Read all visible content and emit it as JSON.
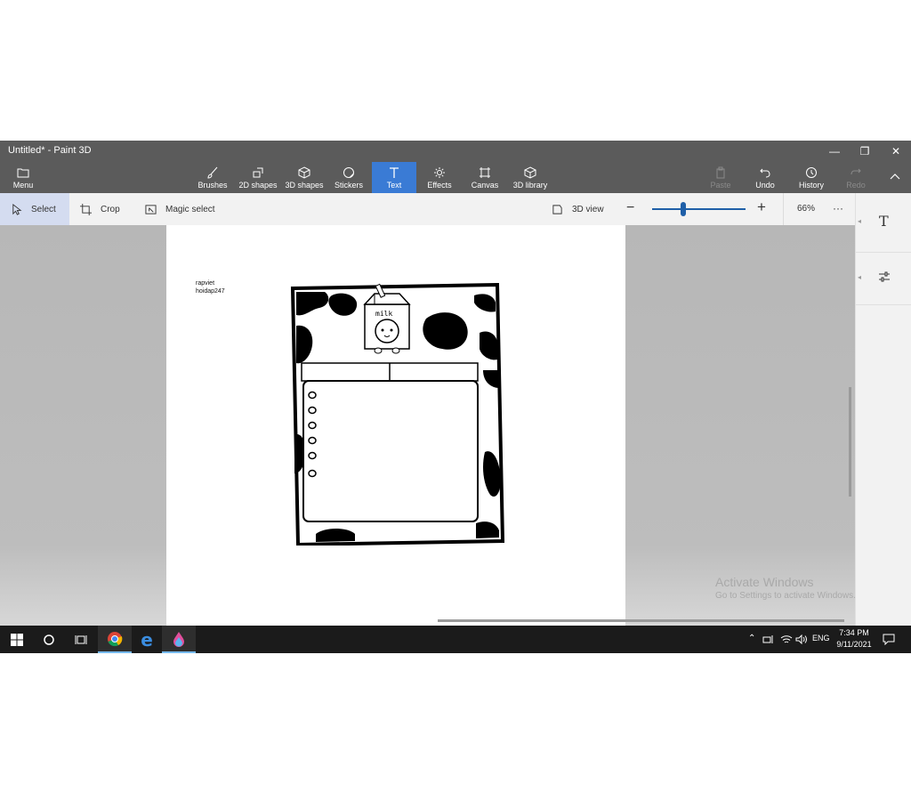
{
  "window": {
    "title": "Untitled* - Paint 3D",
    "minimize_glyph": "—",
    "maximize_glyph": "❐",
    "close_glyph": "✕"
  },
  "ribbon": {
    "menu_label": "Menu",
    "tools": [
      {
        "label": "Brushes",
        "icon": "brush-icon"
      },
      {
        "label": "2D shapes",
        "icon": "2d-shapes-icon"
      },
      {
        "label": "3D shapes",
        "icon": "3d-shapes-icon"
      },
      {
        "label": "Stickers",
        "icon": "stickers-icon"
      },
      {
        "label": "Text",
        "icon": "text-icon",
        "active": true
      },
      {
        "label": "Effects",
        "icon": "effects-icon"
      },
      {
        "label": "Canvas",
        "icon": "canvas-icon"
      },
      {
        "label": "3D library",
        "icon": "3d-library-icon"
      }
    ],
    "actions": [
      {
        "label": "Paste",
        "icon": "paste-icon",
        "disabled": true
      },
      {
        "label": "Undo",
        "icon": "undo-icon"
      },
      {
        "label": "History",
        "icon": "history-icon"
      },
      {
        "label": "Redo",
        "icon": "redo-icon",
        "disabled": true
      }
    ]
  },
  "toolbar": {
    "select_label": "Select",
    "crop_label": "Crop",
    "magic_select_label": "Magic select",
    "view3d_label": "3D view",
    "zoom_value": "66%",
    "zoom_slider_level": 0.33,
    "more_glyph": "···"
  },
  "side_panel": {
    "text_glyph": "T"
  },
  "canvas": {
    "text_line1": "rapviet",
    "text_line2": "hoidap247",
    "milk_label": "milk"
  },
  "watermark": {
    "title": "Activate Windows",
    "subtitle": "Go to Settings to activate Windows."
  },
  "taskbar": {
    "time": "7:34 PM",
    "date": "9/11/2021",
    "language": "ENG"
  },
  "colors": {
    "titlebar": "#5b5b5b",
    "active_tool": "#3a7bd5",
    "slider": "#1f5fa8"
  }
}
